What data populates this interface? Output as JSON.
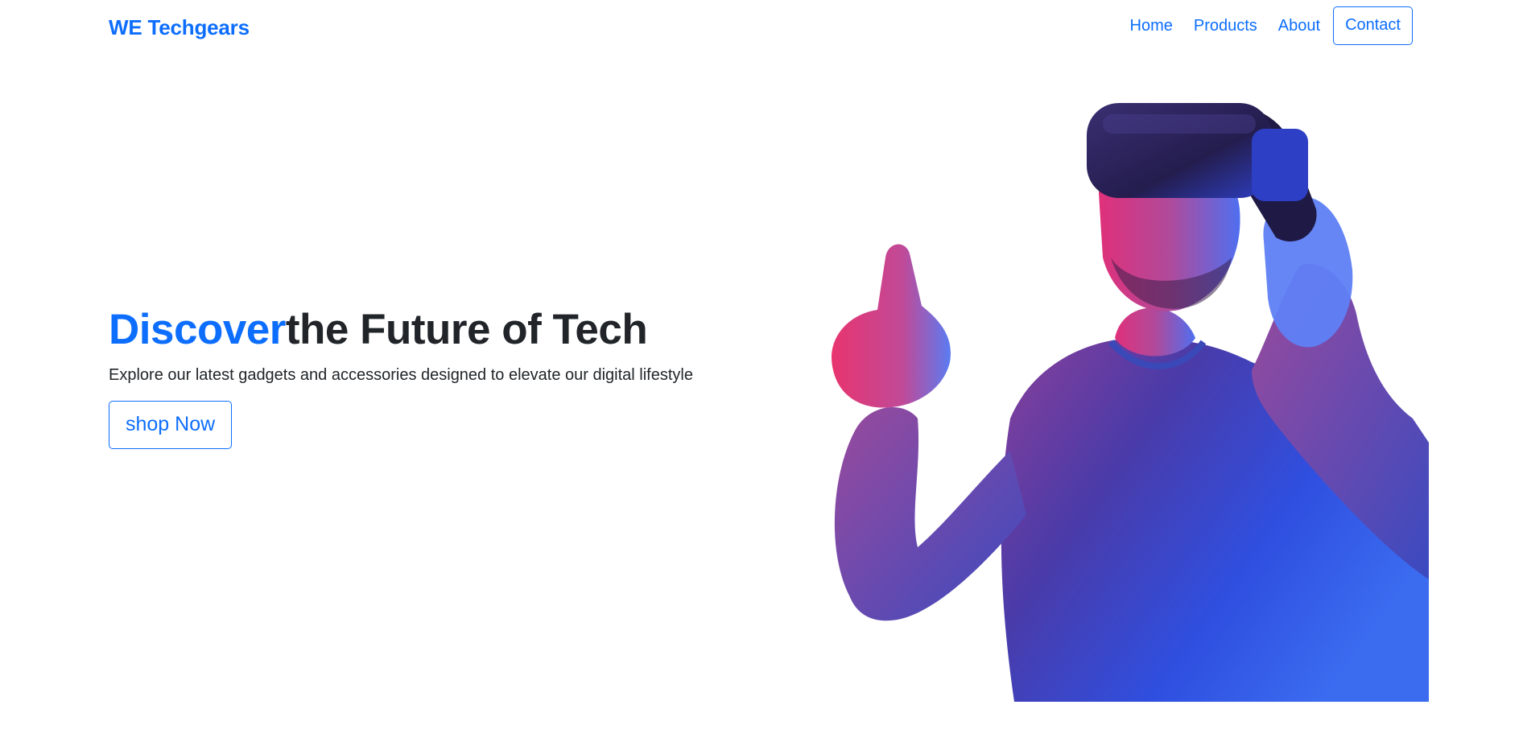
{
  "navbar": {
    "brand": "WE Techgears",
    "links": [
      {
        "label": "Home"
      },
      {
        "label": "Products"
      },
      {
        "label": "About"
      }
    ],
    "contact_label": "Contact"
  },
  "hero": {
    "title_accent": "Discover",
    "title_rest": "the Future of Tech",
    "subtitle": "Explore our latest gadgets and accessories designed to elevate our digital lifestyle",
    "cta_label": "shop Now",
    "image_subject": "man-wearing-vr-headset",
    "colors": {
      "accent": "#0d6efd",
      "text": "#212529",
      "image_blue": "#2f4fe0",
      "image_pink": "#e0307a",
      "headset_dark": "#2a2355"
    }
  }
}
